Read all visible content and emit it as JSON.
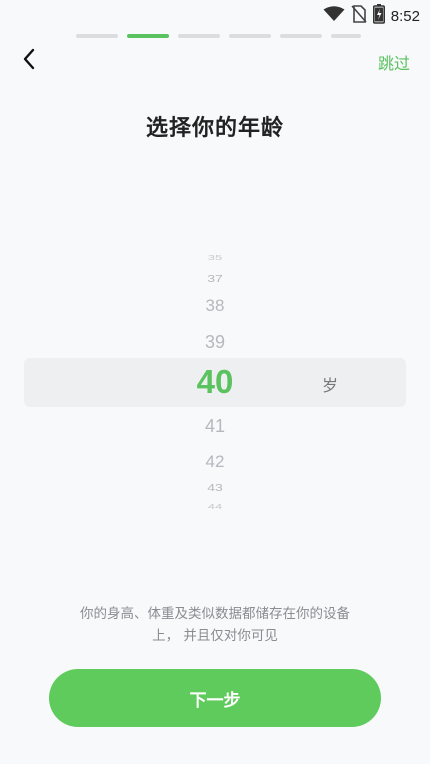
{
  "status_bar": {
    "time": "8:52",
    "icons": [
      "wifi-icon",
      "no-sim-icon",
      "battery-icon"
    ]
  },
  "progress": {
    "total_steps": 6,
    "current_step": 2
  },
  "header": {
    "back_icon": "chevron-left-icon",
    "skip_label": "跳过"
  },
  "title": "选择你的年龄",
  "picker": {
    "items": [
      "35",
      "37",
      "38",
      "39",
      "40",
      "41",
      "42",
      "43",
      "44"
    ],
    "selected": "40",
    "unit": "岁"
  },
  "privacy_note": "你的身高、体重及类似数据都储存在你的设备上， 并且仅对你可见",
  "next_button_label": "下一步",
  "colors": {
    "accent": "#5ac25e",
    "background": "#f8f9fb",
    "highlight_band": "#eeeff1",
    "muted_text": "#8a8c91"
  }
}
